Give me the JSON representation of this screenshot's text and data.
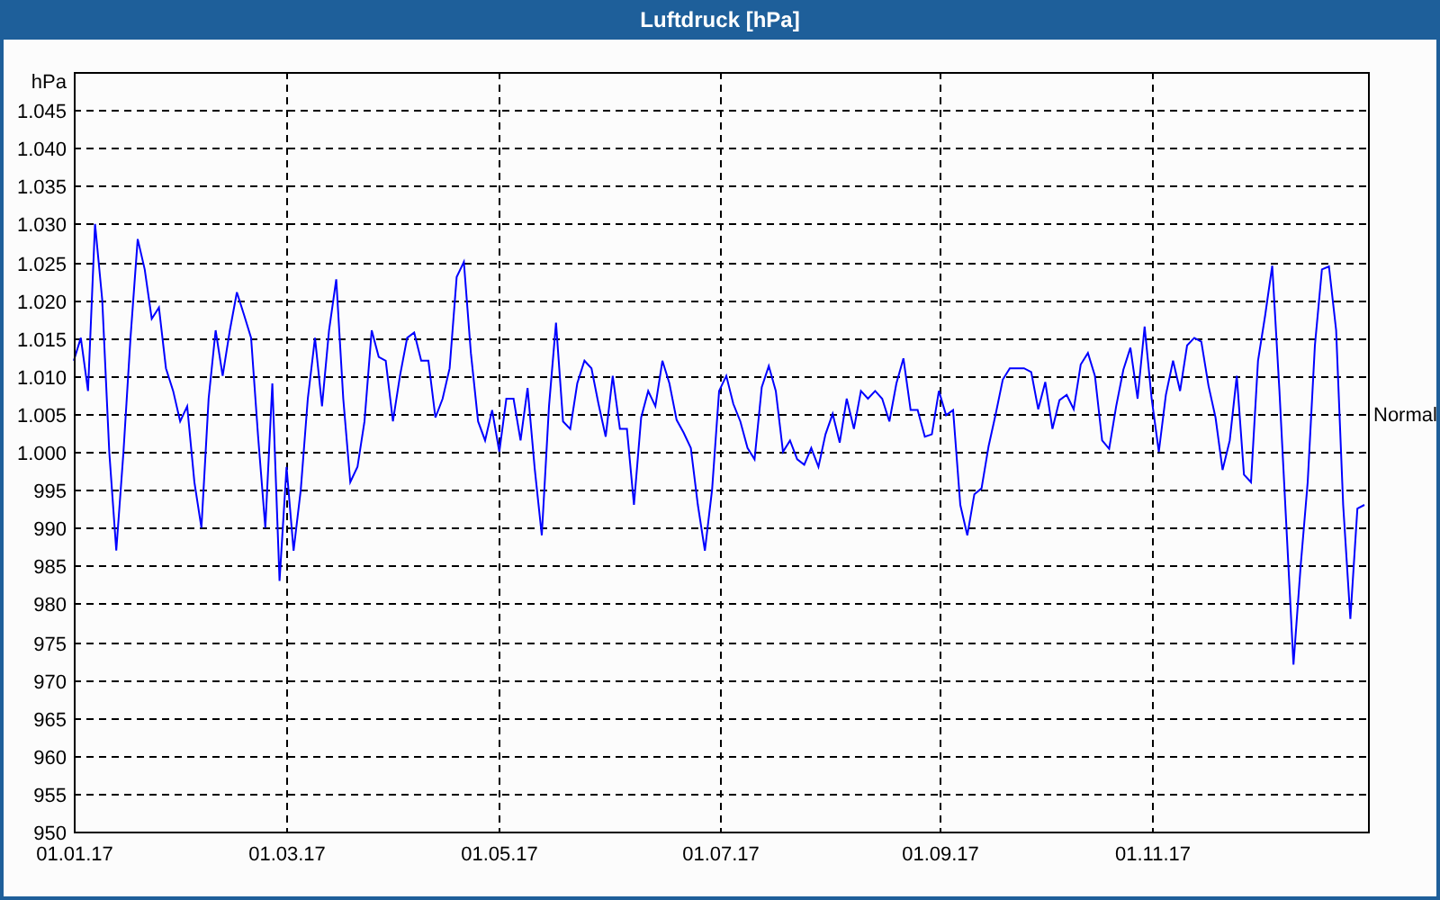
{
  "window": {
    "title": "Luftdruck [hPa]"
  },
  "chart": {
    "chart_data": {
      "type": "line",
      "ylabel": "hPa",
      "categories": [
        "01.01.17",
        null,
        null,
        null,
        null,
        null,
        null,
        null,
        null,
        null,
        null,
        null,
        null,
        null,
        null,
        null,
        null,
        null,
        null,
        null,
        null,
        null,
        null,
        null,
        null,
        null,
        null,
        null,
        null,
        null,
        "01.03.17",
        null,
        null,
        null,
        null,
        null,
        null,
        null,
        null,
        null,
        null,
        null,
        null,
        null,
        null,
        null,
        null,
        null,
        null,
        null,
        null,
        null,
        null,
        null,
        null,
        null,
        null,
        null,
        null,
        null,
        "01.05.17",
        null,
        null,
        null,
        null,
        null,
        null,
        null,
        null,
        null,
        null,
        null,
        null,
        null,
        null,
        null,
        null,
        null,
        null,
        null,
        null,
        null,
        null,
        null,
        null,
        null,
        null,
        null,
        null,
        null,
        null,
        "01.07.17",
        null,
        null,
        null,
        null,
        null,
        null,
        null,
        null,
        null,
        null,
        null,
        null,
        null,
        null,
        null,
        null,
        null,
        null,
        null,
        null,
        null,
        null,
        null,
        null,
        null,
        null,
        null,
        null,
        null,
        null,
        "01.09.17",
        null,
        null,
        null,
        null,
        null,
        null,
        null,
        null,
        null,
        null,
        null,
        null,
        null,
        null,
        null,
        null,
        null,
        null,
        null,
        null,
        null,
        null,
        null,
        null,
        null,
        null,
        null,
        null,
        null,
        "01.11.17",
        null,
        null,
        null,
        null,
        null,
        null,
        null,
        null,
        null,
        null,
        null,
        null,
        null,
        null,
        null,
        null,
        null,
        null,
        null,
        null,
        null,
        null,
        null,
        null,
        null,
        null,
        null,
        null,
        null,
        null
      ],
      "series": [
        {
          "color": "#0000ff",
          "values": [
            1012,
            1015,
            1008,
            1030,
            1020,
            1000,
            987,
            1000,
            1015,
            1028,
            1024,
            1017.5,
            1019,
            1011,
            1008,
            1004,
            1006,
            996,
            990,
            1007,
            1016,
            1010,
            1016,
            1021,
            1018,
            1015,
            1002,
            990,
            1009,
            983,
            998,
            987,
            995,
            1007,
            1015,
            1006,
            1016,
            1022.7,
            1007,
            996,
            998,
            1004,
            1016,
            1012.5,
            1012,
            1004,
            1010,
            1015,
            1015.7,
            1012,
            1012,
            1004.5,
            1007,
            1011,
            1023,
            1025,
            1013,
            1004,
            1001.5,
            1005.5,
            1000,
            1007,
            1007,
            1001.5,
            1008.4,
            997.7,
            989,
            1006,
            1017,
            1004,
            1003,
            1009,
            1012,
            1011,
            1006.3,
            1002,
            1010,
            1003,
            1003,
            993,
            1004.5,
            1008,
            1006,
            1012,
            1009,
            1004.2,
            1002.5,
            1000.5,
            993,
            987,
            995,
            1008,
            1010,
            1006.3,
            1004,
            1000.5,
            999,
            1008.5,
            1011.3,
            1008,
            1000,
            1001.5,
            999,
            998.3,
            1000.5,
            998,
            1002.3,
            1005,
            1001.2,
            1007,
            1003,
            1008,
            1007,
            1008,
            1007,
            1004,
            1009,
            1012.3,
            1005.5,
            1005.5,
            1002,
            1002.3,
            1008,
            1004.8,
            1005.5,
            993,
            989,
            994.4,
            995.2,
            1000.7,
            1005,
            1009.5,
            1011,
            1011,
            1011,
            1010.5,
            1005.6,
            1009.2,
            1003,
            1006.8,
            1007.5,
            1005.6,
            1011.5,
            1013,
            1010,
            1001.5,
            1000.4,
            1006,
            1010.8,
            1013.7,
            1007,
            1016.5,
            1007,
            1000,
            1007.5,
            1012,
            1008,
            1014,
            1015,
            1014.5,
            1008.7,
            1004.5,
            997.6,
            1001.5,
            1010,
            997,
            996,
            1012,
            1018,
            1024.5,
            1008,
            990,
            972,
            985,
            996,
            1014,
            1024,
            1024.4,
            1016,
            993,
            978,
            992.5,
            993
          ]
        }
      ],
      "ylim": [
        950,
        1050
      ],
      "grid": true,
      "yticks": [
        {
          "value": 950,
          "label": "950"
        },
        {
          "value": 955,
          "label": "955"
        },
        {
          "value": 960,
          "label": "960"
        },
        {
          "value": 965,
          "label": "965"
        },
        {
          "value": 970,
          "label": "970"
        },
        {
          "value": 975,
          "label": "975"
        },
        {
          "value": 980,
          "label": "980"
        },
        {
          "value": 985,
          "label": "985"
        },
        {
          "value": 990,
          "label": "990"
        },
        {
          "value": 995,
          "label": "995"
        },
        {
          "value": 1000,
          "label": "1.000"
        },
        {
          "value": 1005,
          "label": "1.005"
        },
        {
          "value": 1010,
          "label": "1.010"
        },
        {
          "value": 1015,
          "label": "1.015"
        },
        {
          "value": 1020,
          "label": "1.020"
        },
        {
          "value": 1025,
          "label": "1.025"
        },
        {
          "value": 1030,
          "label": "1.030"
        },
        {
          "value": 1035,
          "label": "1.035"
        },
        {
          "value": 1040,
          "label": "1.040"
        },
        {
          "value": 1045,
          "label": "1.045"
        }
      ],
      "annotations": [
        "Normal"
      ]
    }
  }
}
